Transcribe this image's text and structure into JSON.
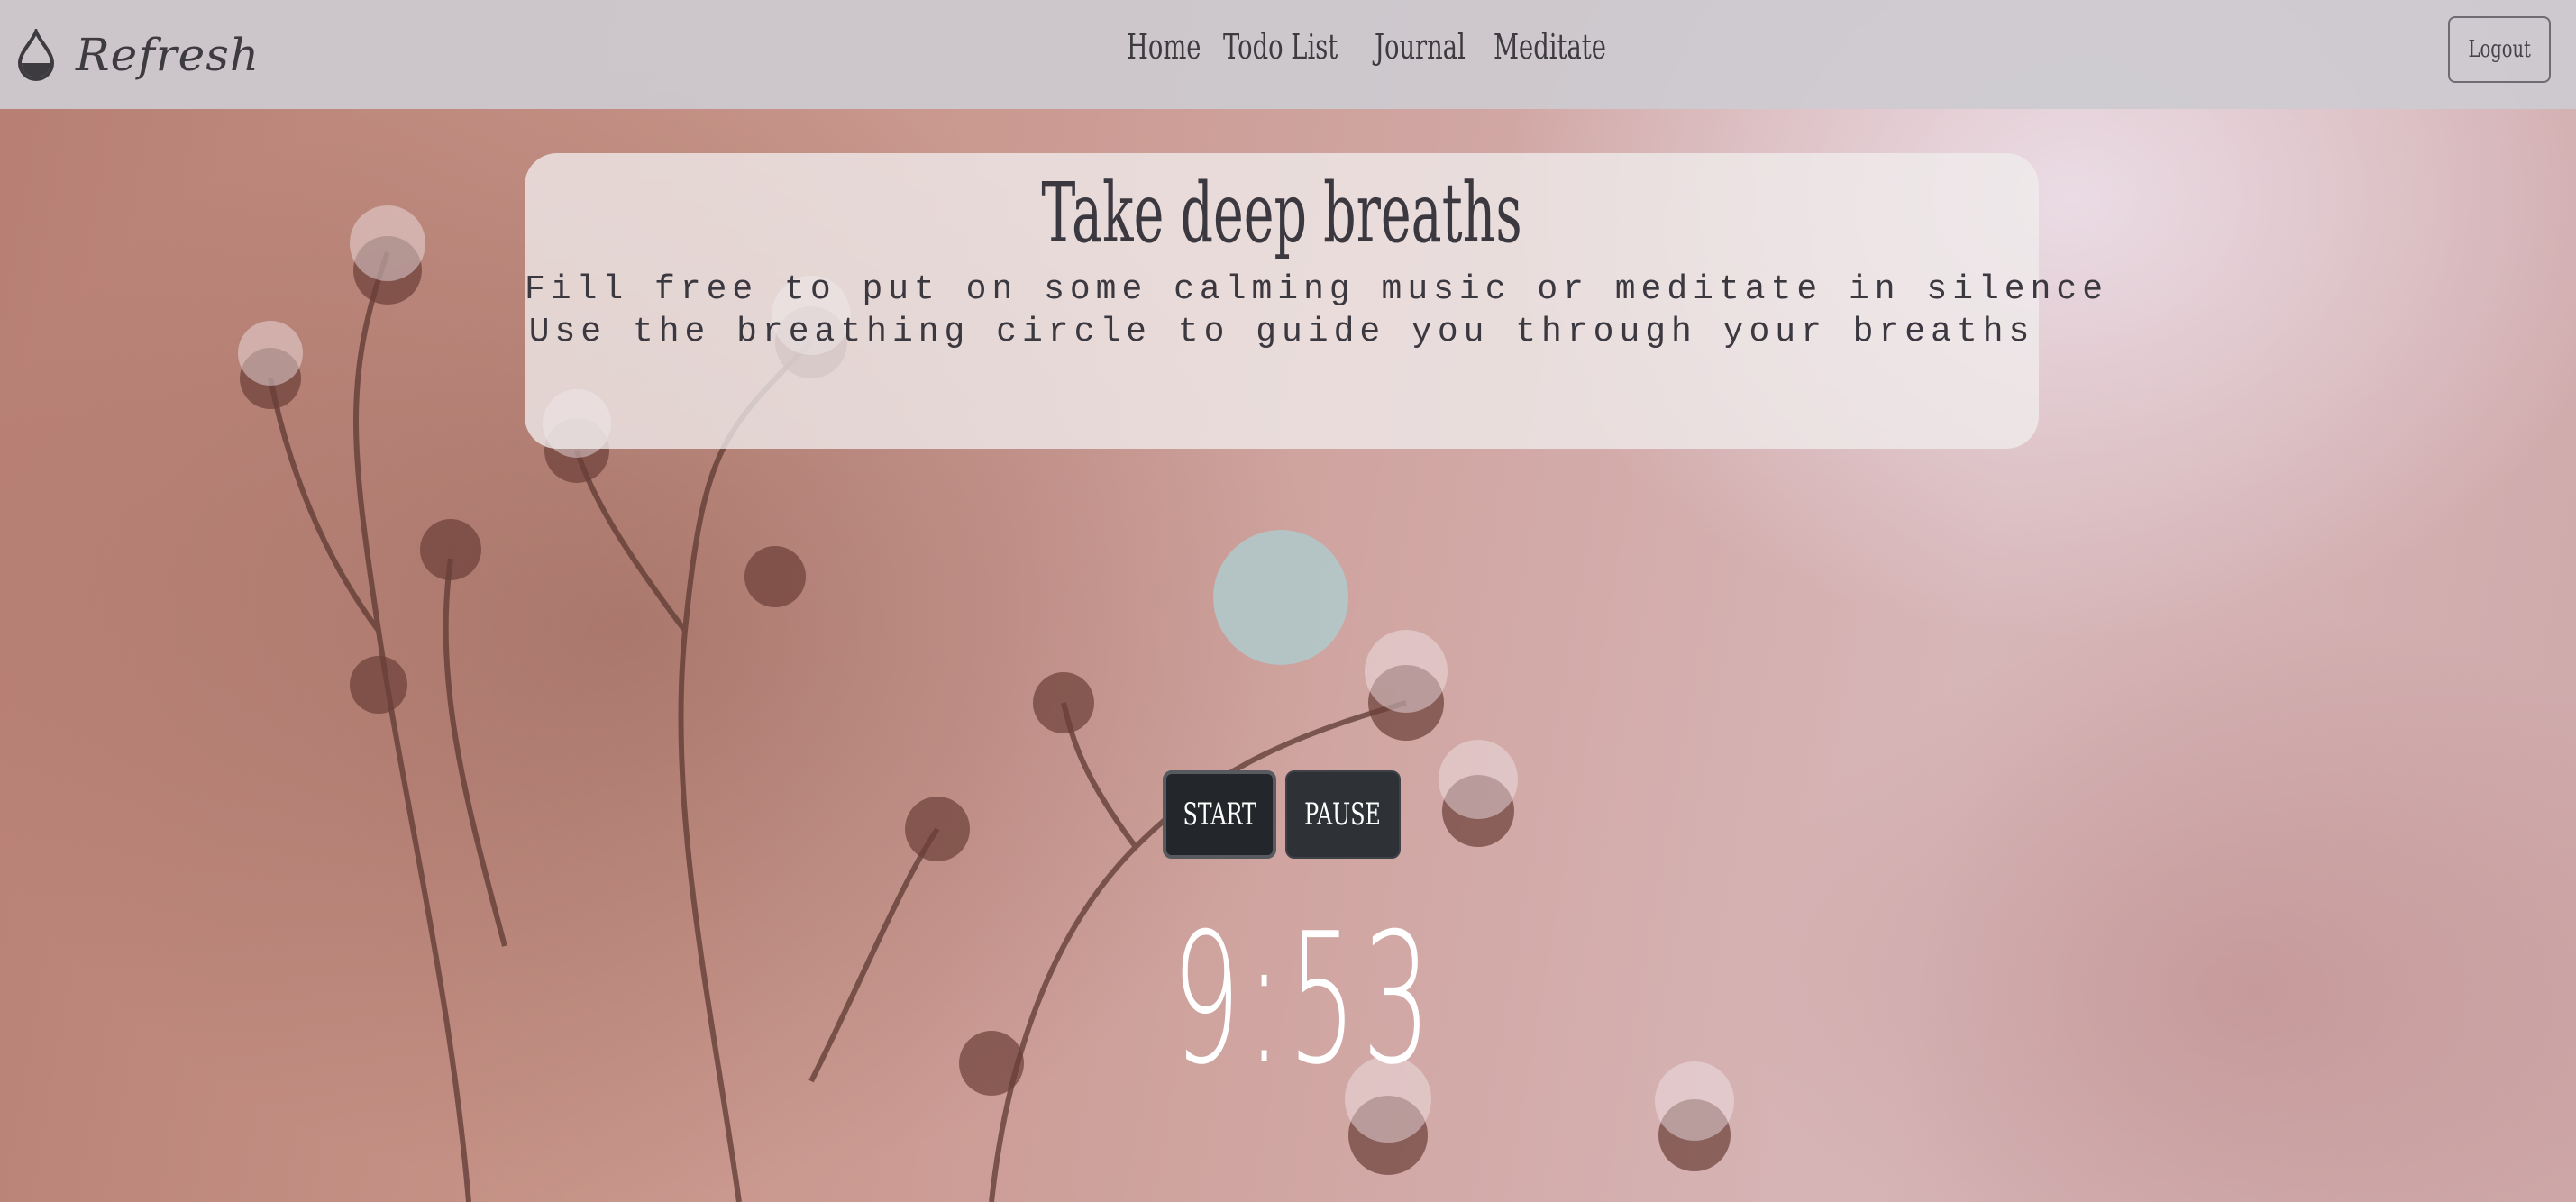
{
  "app": {
    "brand_name": "Refresh",
    "brand_icon": "water-drop-icon"
  },
  "nav": {
    "links": [
      {
        "label": "Home"
      },
      {
        "label": "Todo List"
      },
      {
        "label": "Journal"
      },
      {
        "label": "Meditate"
      }
    ],
    "logout_label": "Logout"
  },
  "card": {
    "title": "Take deep breaths",
    "line1": "Fill free to put on some calming music or meditate in silence",
    "line2": "Use the breathing circle to guide you through your breaths"
  },
  "controls": {
    "start_label": "START",
    "pause_label": "PAUSE"
  },
  "timer": {
    "value": "9:53"
  },
  "colors": {
    "navbar_bg": "#cdcbd0",
    "text_dark": "#3b3840",
    "button_dark": "#2e3237",
    "circle": "#b0c8ca",
    "timer_text": "#ffffff"
  }
}
